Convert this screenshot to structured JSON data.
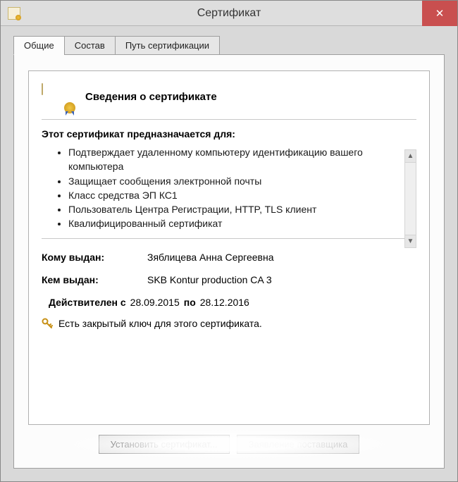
{
  "window": {
    "title": "Сертификат"
  },
  "tabs": [
    {
      "label": "Общие",
      "active": true
    },
    {
      "label": "Состав",
      "active": false
    },
    {
      "label": "Путь сертификации",
      "active": false
    }
  ],
  "header": {
    "title": "Сведения о сертификате"
  },
  "purpose": {
    "title": "Этот сертификат предназначается для:",
    "items": [
      "Подтверждает удаленному компьютеру идентификацию вашего компьютера",
      "Защищает сообщения электронной почты",
      "Класс средства ЭП КС1",
      "Пользователь Центра Регистрации, HTTP, TLS клиент",
      "Квалифицированный сертификат"
    ]
  },
  "fields": {
    "issued_to_label": "Кому выдан:",
    "issued_to_value": "Зяблицева Анна Сергеевна",
    "issued_by_label": "Кем выдан:",
    "issued_by_value": "SKB Kontur production CA 3"
  },
  "validity": {
    "prefix": "Действителен с",
    "from": "28.09.2015",
    "middle": "по",
    "to": "28.12.2016"
  },
  "key_message": "Есть закрытый ключ для этого сертификата.",
  "actions": {
    "install": "Установить сертификат...",
    "statement": "Заявление поставщика"
  }
}
